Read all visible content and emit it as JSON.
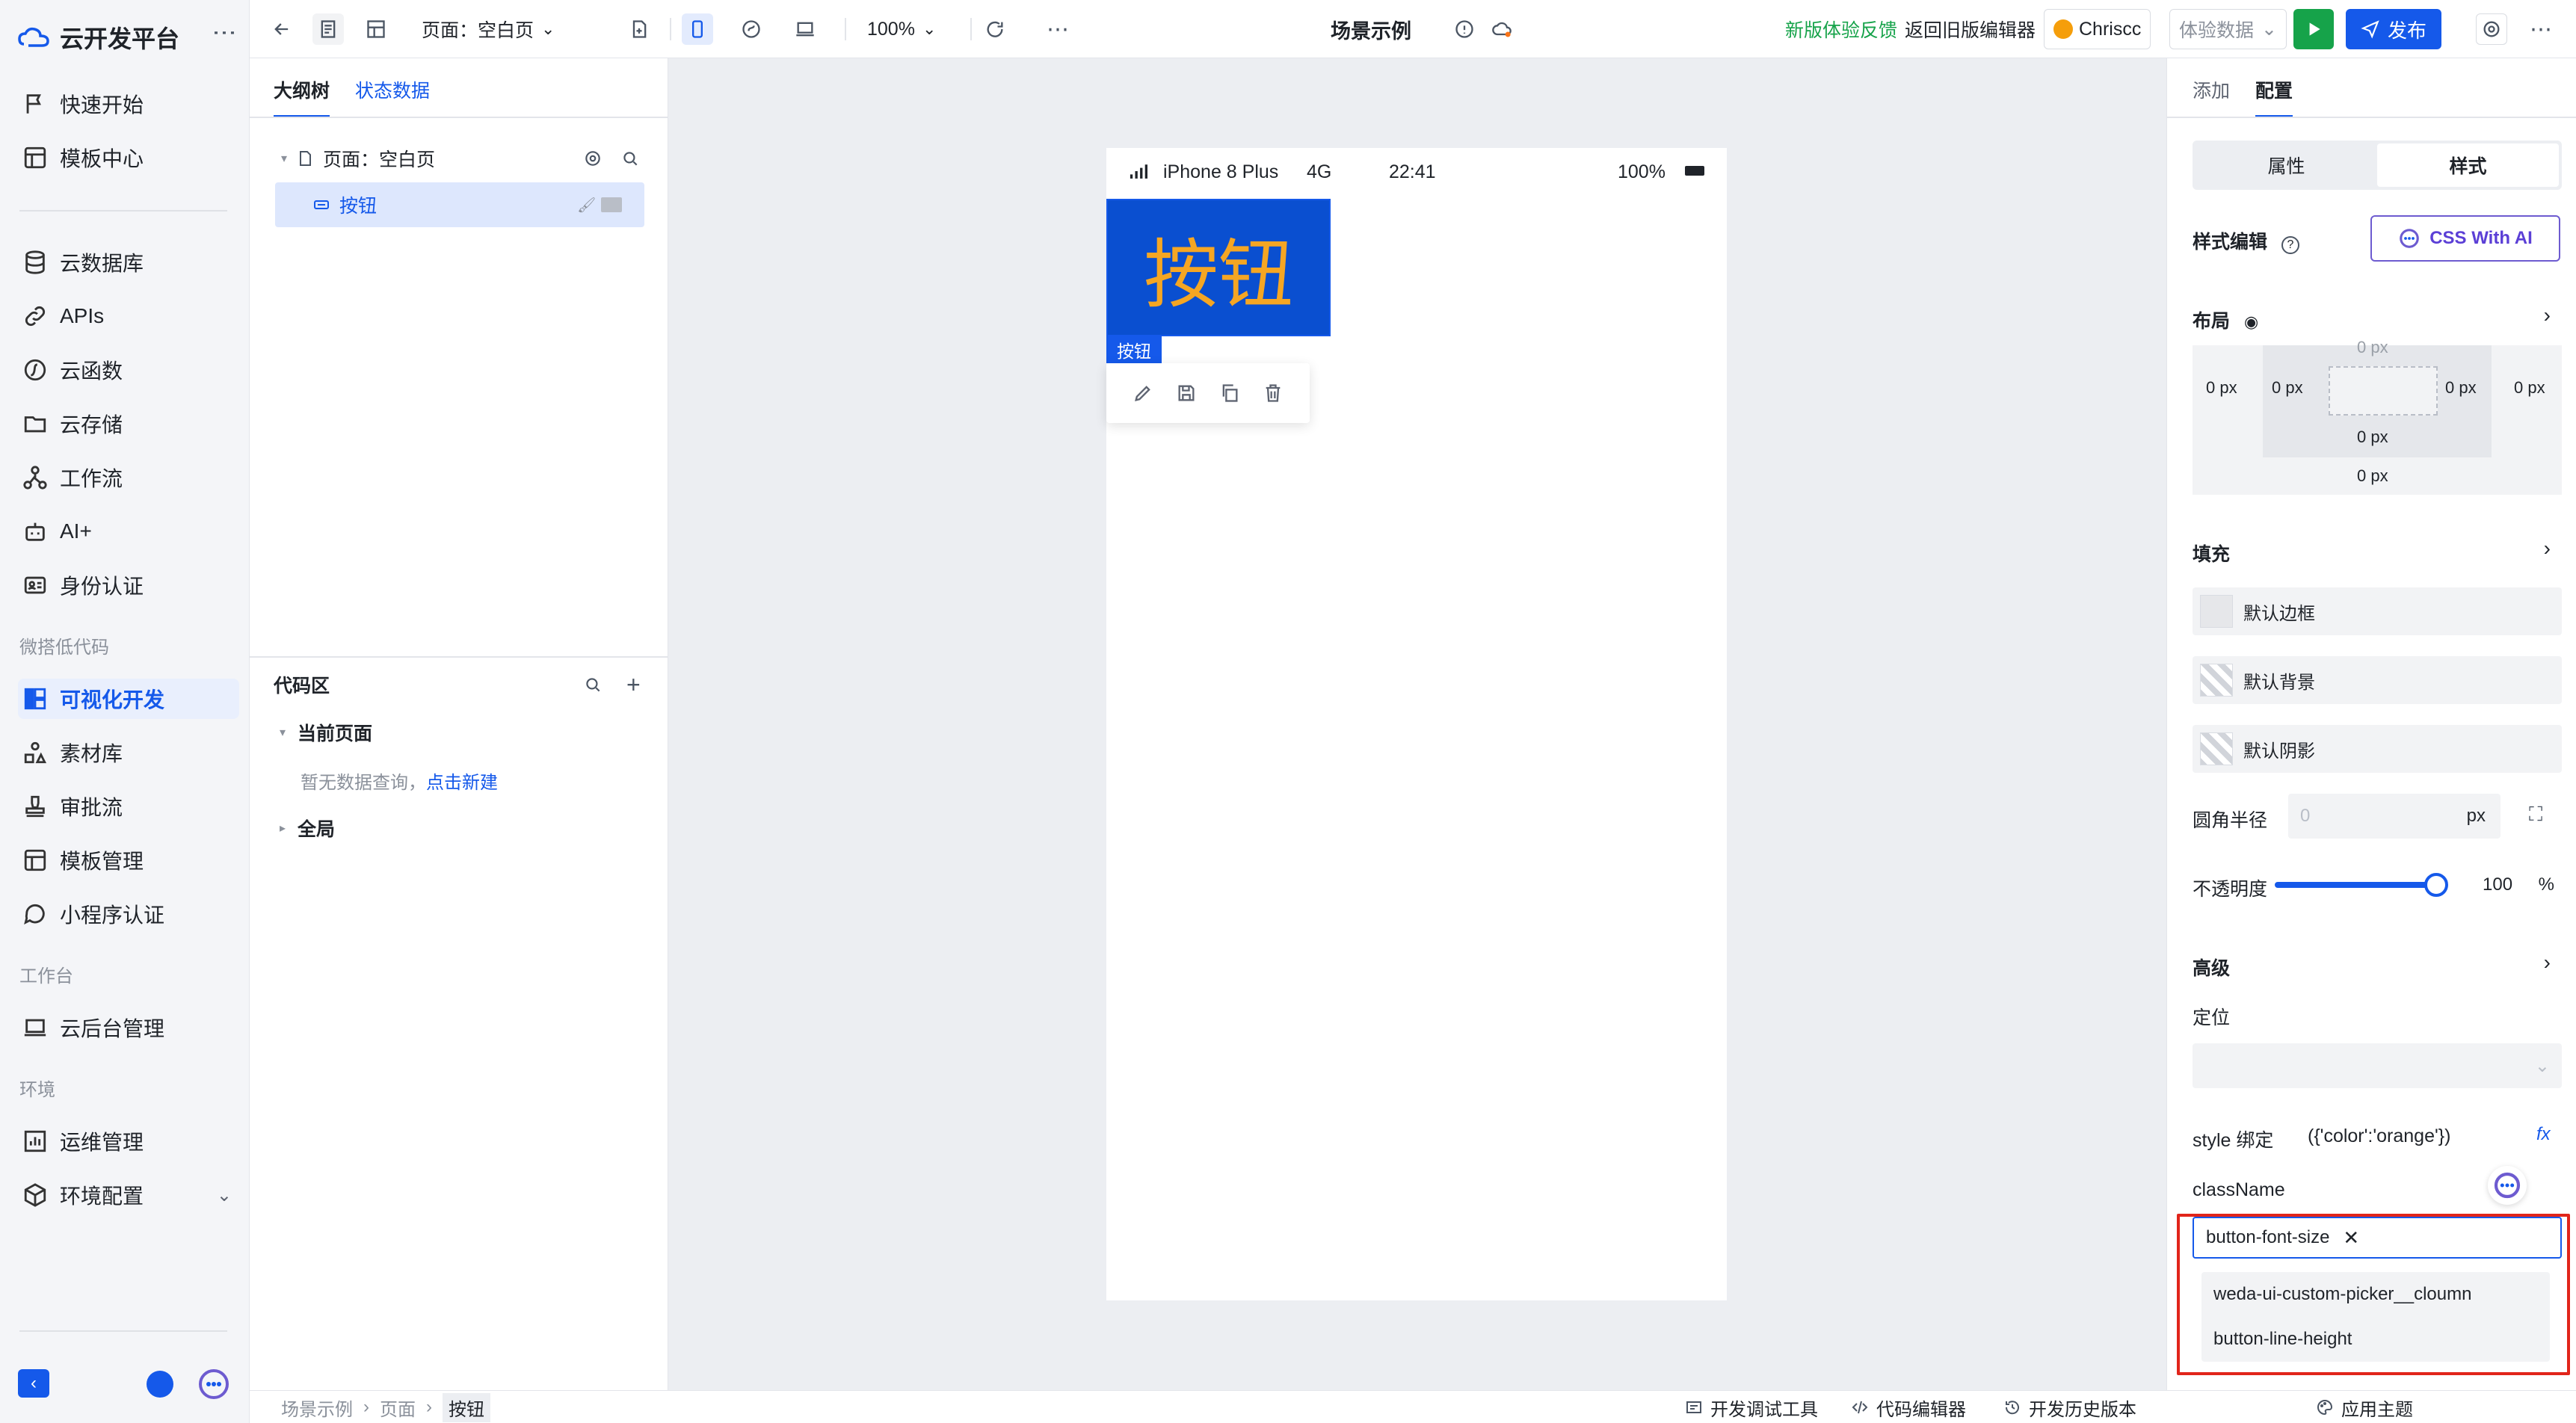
{
  "sidebar": {
    "brand": "云开发平台",
    "items_top": [
      {
        "label": "快速开始",
        "icon": "flag-icon"
      },
      {
        "label": "模板中心",
        "icon": "template-icon"
      }
    ],
    "items_mid": [
      {
        "label": "云数据库",
        "icon": "database-icon"
      },
      {
        "label": "APIs",
        "icon": "link-icon"
      },
      {
        "label": "云函数",
        "icon": "function-icon"
      },
      {
        "label": "云存储",
        "icon": "folder-icon"
      },
      {
        "label": "工作流",
        "icon": "workflow-icon"
      },
      {
        "label": "AI+",
        "icon": "robot-icon"
      },
      {
        "label": "身份认证",
        "icon": "id-card-icon"
      }
    ],
    "section_lowcode": "微搭低代码",
    "items_lowcode": [
      {
        "label": "可视化开发",
        "icon": "layout-icon"
      },
      {
        "label": "素材库",
        "icon": "shapes-icon"
      },
      {
        "label": "审批流",
        "icon": "stamp-icon"
      },
      {
        "label": "模板管理",
        "icon": "template-icon"
      },
      {
        "label": "小程序认证",
        "icon": "chat-icon"
      }
    ],
    "section_workbench": "工作台",
    "items_workbench": [
      {
        "label": "云后台管理",
        "icon": "laptop-icon"
      }
    ],
    "section_env": "环境",
    "items_env": [
      {
        "label": "运维管理",
        "icon": "chart-icon"
      },
      {
        "label": "环境配置",
        "icon": "cube-icon"
      }
    ]
  },
  "topbar": {
    "page_select": "页面：空白页",
    "zoom": "100%",
    "title": "场景示例",
    "feedback": "新版体验反馈",
    "back_old": "返回旧版编辑器",
    "user": "Chriscc",
    "data_select": "体验数据",
    "publish": "发布"
  },
  "outline": {
    "tabs": [
      "大纲树",
      "状态数据"
    ],
    "tree": [
      {
        "label": "页面：空白页"
      },
      {
        "label": "按钮"
      }
    ],
    "code_title": "代码区",
    "current_page": "当前页面",
    "empty_text": "暂无数据查询，",
    "create_link": "点击新建",
    "global": "全局"
  },
  "canvas": {
    "status": {
      "carrier": "iPhone 8 Plus",
      "network": "4G",
      "time": "22:41",
      "battery": "100%"
    },
    "button_text": "按钮",
    "tag_text": "按钮"
  },
  "right": {
    "tabs": [
      "添加",
      "配置"
    ],
    "seg": [
      "属性",
      "样式"
    ],
    "style_edit": "样式编辑",
    "css_ai": "CSS With AI",
    "layout": "布局",
    "box": {
      "outer_left": "0 px",
      "inner_left": "0 px",
      "inner_right": "0 px",
      "outer_right": "0 px",
      "inner_bottom": "0 px",
      "outer_bottom": "0 px",
      "top_clip": "0 px"
    },
    "fill": "填充",
    "fill_items": [
      "默认边框",
      "默认背景",
      "默认阴影"
    ],
    "radius_label": "圆角半径",
    "radius_placeholder": "0",
    "radius_unit": "px",
    "opacity_label": "不透明度",
    "opacity_value": "100",
    "opacity_unit": "%",
    "opacity_level": 1.0,
    "advanced": "高级",
    "position": "定位",
    "style_bind_label": "style 绑定",
    "style_bind_value": "({'color':'orange'})",
    "fx": "fx",
    "classname_label": "className",
    "chip": "button-font-size",
    "options": [
      "weda-ui-custom-picker__cloumn",
      "button-line-height"
    ]
  },
  "bottom": {
    "crumbs": [
      "场景示例",
      "页面",
      "按钮"
    ],
    "debug": "开发调试工具",
    "code_editor": "代码编辑器",
    "history": "开发历史版本",
    "theme": "应用主题"
  }
}
